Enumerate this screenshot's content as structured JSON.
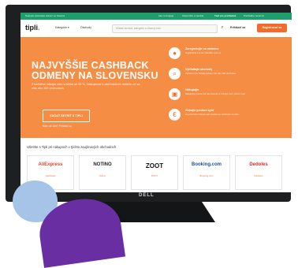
{
  "topbar": {
    "left": "Nakupte prekvapte sobom so zlavami",
    "right_1": "Ako to funguje",
    "right_2": "Odporúčte a zarobte",
    "right_3": "Tipli pre prehliadač",
    "right_4": "Prehľadné recenzie"
  },
  "header": {
    "logo_main": "tipli",
    "logo_dot": ".",
    "nav_1": "Kategórie ▾",
    "nav_2": "Obchody",
    "search_placeholder": "Hľadať obchod, kategóriu a zľavový kód",
    "login": "Prihlásiť sa",
    "register": "Registrovať sa"
  },
  "hero": {
    "title_line_1": "NAJVYŠŠIE CASHBACK",
    "title_line_2": "ODMENY NA SLOVENSKU",
    "text": "Z každého nákupu vám vrátime až 25 %. Nakupovať s cashbackom môžete už vo viac ako 100 obchodoch.",
    "button": "ZAČAŤ ŠETRIŤ S TIPLI",
    "link": "Mám už účet? Prihlásiť sa"
  },
  "steps": [
    {
      "icon": "user-icon",
      "glyph": "👤",
      "title": "Zaregistrujte sa zadarmo",
      "desc": "Registrácia trvá len niekoľko sekúnd"
    },
    {
      "icon": "search-icon",
      "glyph": "🔍",
      "title": "Vyhľadajte obchody",
      "desc": "Vyberte si zo širokej ponuky viac ako 100 obchodov"
    },
    {
      "icon": "cart-icon",
      "glyph": "🛒",
      "title": "Nakupujte",
      "desc": "Nakupujte presne tak ako doteraz a získajte časť peňazí späť"
    },
    {
      "icon": "money-icon",
      "glyph": "💶",
      "title": "Získajte peniaze späť",
      "desc": "Po potvrdení nákupu vám pripíšeme cashback na účet"
    }
  ],
  "partners": {
    "title": "Ušetrite s Tipli pri nákupoch v týchto zaujímavých obchodoch",
    "cards": [
      {
        "brand": "AliExpress",
        "cashback": "Cashback",
        "color": "#e8442b"
      },
      {
        "brand": "NOTINO",
        "cashback": "Notino",
        "color": "#222222"
      },
      {
        "brand": "ZOOT",
        "cashback": "ZOOT",
        "color": "#111111"
      },
      {
        "brand": "Booking.com",
        "cashback": "Booking.com",
        "color": "#1d4e9a"
      },
      {
        "brand": "Dedoles",
        "cashback": "Dedoles",
        "color": "#e22a2a"
      }
    ]
  },
  "monitor": {
    "brand": "DELL"
  },
  "colors": {
    "accent": "#f26b2a",
    "hero": "#f58d45",
    "topbar": "#1e9e6a",
    "bezel": "#1e1f21"
  }
}
